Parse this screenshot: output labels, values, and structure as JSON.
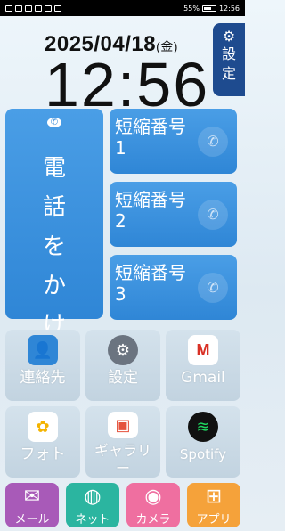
{
  "status_bar": {
    "battery": "55%",
    "time": "12:56"
  },
  "clock": {
    "date": "2025/04/18",
    "weekday": "(金)",
    "time": "12:56"
  },
  "settings_tab": {
    "label": "設定",
    "icon": "gear-icon",
    "color": "#1e4b8f"
  },
  "call_button": {
    "label": "電話をかける",
    "icon": "phone-icon",
    "color": "#3b90dd"
  },
  "speed_dials": [
    {
      "label": "短縮番号1",
      "icon": "phone-icon"
    },
    {
      "label": "短縮番号2",
      "icon": "phone-icon"
    },
    {
      "label": "短縮番号3",
      "icon": "phone-icon"
    }
  ],
  "apps": [
    {
      "label": "連絡先",
      "icon": "contacts-icon",
      "color": "#2f86d6"
    },
    {
      "label": "設定",
      "icon": "gear-icon",
      "color": "#6b7480"
    },
    {
      "label": "Gmail",
      "icon": "gmail-icon",
      "color": "#ffffff"
    },
    {
      "label": "フォト",
      "icon": "photos-icon",
      "color": "#ffffff"
    },
    {
      "label": "ギャラリー",
      "icon": "gallery-icon",
      "color": "#ffffff"
    },
    {
      "label": "Spotify",
      "icon": "spotify-icon",
      "color": "#1ed760"
    }
  ],
  "dock": [
    {
      "label": "メール",
      "icon": "mail-icon",
      "color": "#a85ab8"
    },
    {
      "label": "ネット",
      "icon": "globe-icon",
      "color": "#2bb5a0"
    },
    {
      "label": "カメラ",
      "icon": "camera-icon",
      "color": "#ef6fa0"
    },
    {
      "label": "アプリ",
      "icon": "apps-grid-icon",
      "color": "#f5a23a"
    }
  ]
}
